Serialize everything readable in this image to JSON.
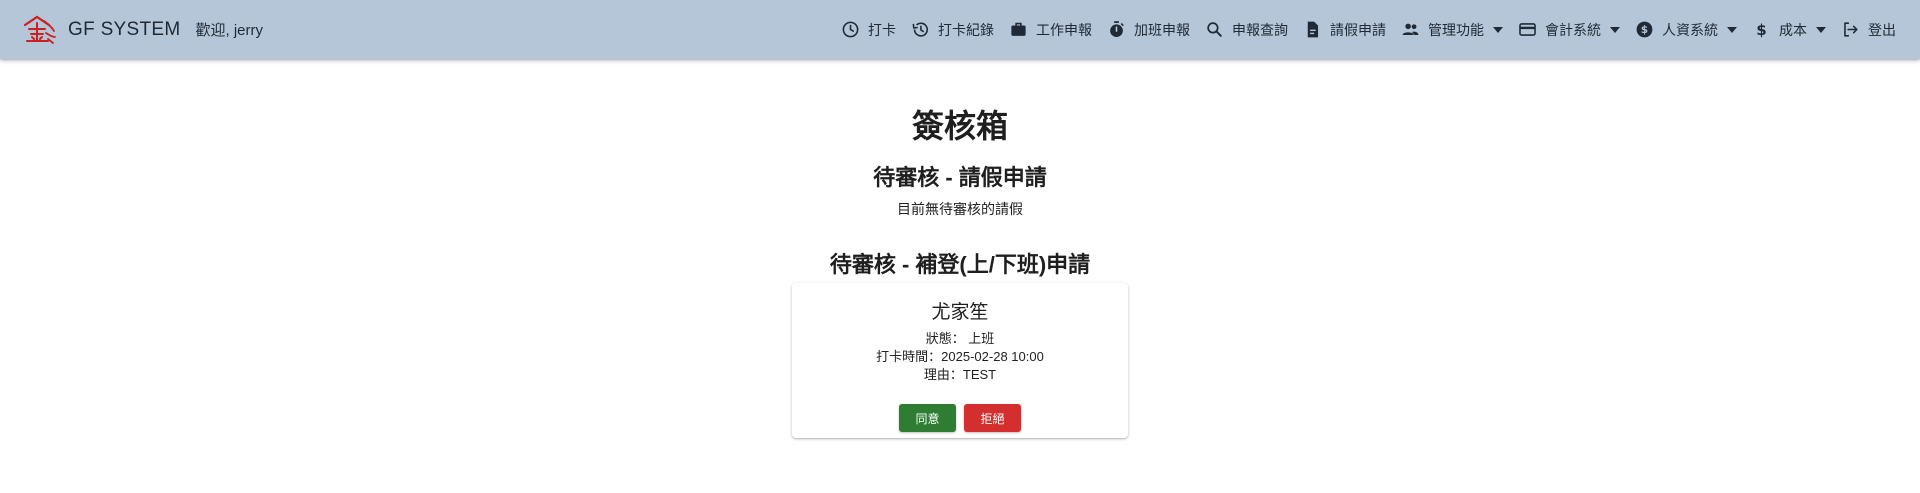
{
  "header": {
    "brand": "GF SYSTEM",
    "logo_text": "金璽",
    "welcome": "歡迎, jerry",
    "bg_color": "#b4c6d8"
  },
  "nav": [
    {
      "label": "打卡",
      "icon": "clock-icon"
    },
    {
      "label": "打卡紀錄",
      "icon": "history-icon"
    },
    {
      "label": "工作申報",
      "icon": "briefcase-icon"
    },
    {
      "label": "加班申報",
      "icon": "timer-icon"
    },
    {
      "label": "申報查詢",
      "icon": "search-icon"
    },
    {
      "label": "請假申請",
      "icon": "document-icon"
    },
    {
      "label": "管理功能",
      "icon": "people-icon",
      "dropdown": true
    },
    {
      "label": "會計系統",
      "icon": "credit-card-icon",
      "dropdown": true
    },
    {
      "label": "人資系統",
      "icon": "dollar-circle-icon",
      "dropdown": true
    },
    {
      "label": "成本",
      "icon": "dollar-icon",
      "dropdown": true
    },
    {
      "label": "登出",
      "icon": "logout-icon"
    }
  ],
  "main": {
    "title": "簽核箱",
    "leave_section": {
      "title": "待審核 - 請假申請",
      "empty_message": "目前無待審核的請假"
    },
    "punch_section": {
      "title": "待審核 - 補登(上/下班)申請",
      "cards": [
        {
          "name": "尤家笙",
          "status": "狀態： 上班",
          "punch_time": "打卡時間：2025-02-28 10:00",
          "reason": "理由：TEST",
          "approve_label": "同意",
          "reject_label": "拒絕"
        }
      ]
    }
  },
  "colors": {
    "approve": "#2e7d32",
    "reject": "#d32f2f",
    "logo_red": "#cc1f1f"
  }
}
